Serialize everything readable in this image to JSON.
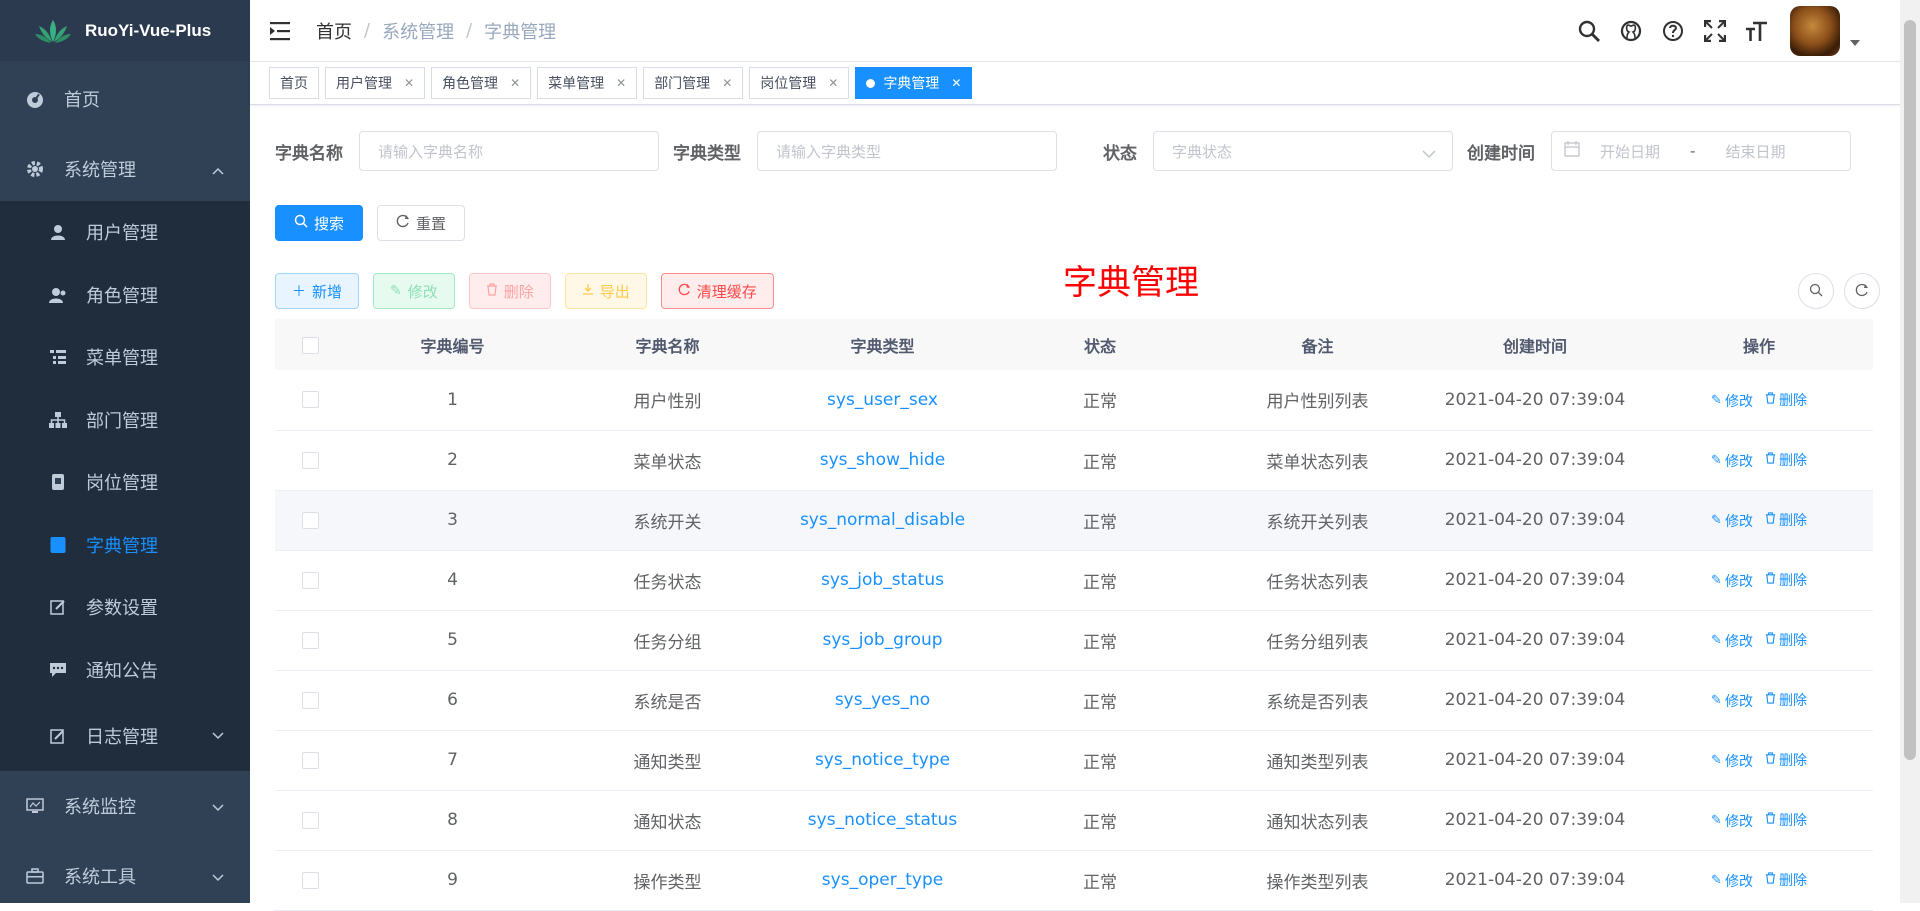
{
  "app": {
    "title": "RuoYi-Vue-Plus"
  },
  "sidebar": {
    "items": [
      {
        "label": "首页",
        "icon": "dashboard-icon"
      },
      {
        "label": "系统管理",
        "icon": "gear-icon",
        "expanded": true
      }
    ],
    "sub_items": [
      {
        "label": "用户管理",
        "icon": "user-icon"
      },
      {
        "label": "角色管理",
        "icon": "peoples-icon"
      },
      {
        "label": "菜单管理",
        "icon": "tree-table-icon"
      },
      {
        "label": "部门管理",
        "icon": "tree-icon"
      },
      {
        "label": "岗位管理",
        "icon": "post-icon"
      },
      {
        "label": "字典管理",
        "icon": "dict-icon",
        "active": true
      },
      {
        "label": "参数设置",
        "icon": "edit-icon"
      },
      {
        "label": "通知公告",
        "icon": "message-icon"
      },
      {
        "label": "日志管理",
        "icon": "log-icon"
      }
    ],
    "bottom_items": [
      {
        "label": "系统监控",
        "icon": "monitor-icon"
      },
      {
        "label": "系统工具",
        "icon": "tool-icon"
      }
    ]
  },
  "navbar": {
    "breadcrumb": [
      "首页",
      "系统管理",
      "字典管理"
    ],
    "separator": "/"
  },
  "tags": [
    {
      "label": "首页",
      "closable": false
    },
    {
      "label": "用户管理",
      "closable": true
    },
    {
      "label": "角色管理",
      "closable": true
    },
    {
      "label": "菜单管理",
      "closable": true
    },
    {
      "label": "部门管理",
      "closable": true
    },
    {
      "label": "岗位管理",
      "closable": true
    },
    {
      "label": "字典管理",
      "closable": true,
      "active": true
    }
  ],
  "search": {
    "dict_name_label": "字典名称",
    "dict_name_placeholder": "请输入字典名称",
    "dict_type_label": "字典类型",
    "dict_type_placeholder": "请输入字典类型",
    "status_label": "状态",
    "status_placeholder": "字典状态",
    "created_label": "创建时间",
    "start_placeholder": "开始日期",
    "range_sep": "-",
    "end_placeholder": "结束日期",
    "search_btn": "搜索",
    "reset_btn": "重置"
  },
  "toolbar": {
    "add": "新增",
    "edit": "修改",
    "delete": "删除",
    "export": "导出",
    "clear_cache": "清理缓存",
    "page_heading": "字典管理"
  },
  "table": {
    "headers": [
      "字典编号",
      "字典名称",
      "字典类型",
      "状态",
      "备注",
      "创建时间",
      "操作"
    ],
    "edit_label": "修改",
    "delete_label": "删除",
    "rows": [
      {
        "id": "1",
        "name": "用户性别",
        "type": "sys_user_sex",
        "status": "正常",
        "remark": "用户性别列表",
        "created": "2021-04-20 07:39:04"
      },
      {
        "id": "2",
        "name": "菜单状态",
        "type": "sys_show_hide",
        "status": "正常",
        "remark": "菜单状态列表",
        "created": "2021-04-20 07:39:04"
      },
      {
        "id": "3",
        "name": "系统开关",
        "type": "sys_normal_disable",
        "status": "正常",
        "remark": "系统开关列表",
        "created": "2021-04-20 07:39:04"
      },
      {
        "id": "4",
        "name": "任务状态",
        "type": "sys_job_status",
        "status": "正常",
        "remark": "任务状态列表",
        "created": "2021-04-20 07:39:04"
      },
      {
        "id": "5",
        "name": "任务分组",
        "type": "sys_job_group",
        "status": "正常",
        "remark": "任务分组列表",
        "created": "2021-04-20 07:39:04"
      },
      {
        "id": "6",
        "name": "系统是否",
        "type": "sys_yes_no",
        "status": "正常",
        "remark": "系统是否列表",
        "created": "2021-04-20 07:39:04"
      },
      {
        "id": "7",
        "name": "通知类型",
        "type": "sys_notice_type",
        "status": "正常",
        "remark": "通知类型列表",
        "created": "2021-04-20 07:39:04"
      },
      {
        "id": "8",
        "name": "通知状态",
        "type": "sys_notice_status",
        "status": "正常",
        "remark": "通知状态列表",
        "created": "2021-04-20 07:39:04"
      },
      {
        "id": "9",
        "name": "操作类型",
        "type": "sys_oper_type",
        "status": "正常",
        "remark": "操作类型列表",
        "created": "2021-04-20 07:39:04"
      }
    ]
  },
  "colors": {
    "sidebar_bg": "#304156",
    "submenu_bg": "#1f2d3d",
    "primary": "#1890ff",
    "heading_red": "#ff0000"
  }
}
